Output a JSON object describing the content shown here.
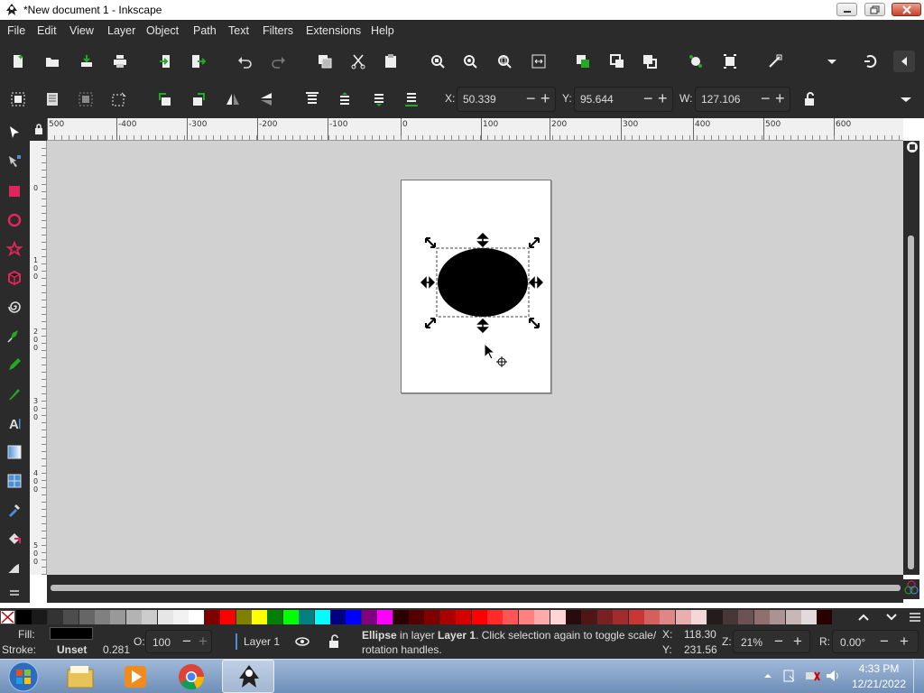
{
  "window": {
    "title": "*New document 1 - Inkscape"
  },
  "menu": [
    {
      "label": "File",
      "u": "F",
      "rest": "ile"
    },
    {
      "label": "Edit",
      "u": "E",
      "rest": "dit"
    },
    {
      "label": "View",
      "u": "V",
      "rest": "iew"
    },
    {
      "label": "Layer",
      "u": "L",
      "rest": "ayer"
    },
    {
      "label": "Object",
      "u": "O",
      "rest": "bject"
    },
    {
      "label": "Path",
      "u": "P",
      "rest": "ath"
    },
    {
      "label": "Text",
      "u": "T",
      "rest": "ext"
    },
    {
      "label": "Filters",
      "u": "F",
      "rest": "ilters"
    },
    {
      "label": "Extensions",
      "u": "x",
      "rest": "tensions",
      "pre": "E"
    },
    {
      "label": "Help",
      "u": "H",
      "rest": "elp"
    }
  ],
  "controls": {
    "x_label": "X:",
    "x_value": "50.339",
    "y_label": "Y:",
    "y_value": "95.644",
    "w_label": "W:",
    "w_value": "127.106"
  },
  "ruler": {
    "top_ticks": [
      "500",
      "-400",
      "-300",
      "-200",
      "-100",
      "0",
      "100",
      "200",
      "300",
      "400",
      "500",
      "600"
    ],
    "left_ticks": [
      "0",
      "1\n0\n0",
      "2\n0\n0",
      "3\n0\n0",
      "4\n0\n0",
      "5\n0\n0"
    ]
  },
  "status": {
    "fill_label": "Fill:",
    "stroke_label": "Stroke:",
    "stroke_value": "Unset",
    "stroke_width": "0.281",
    "opacity_label": "O:",
    "opacity_value": "100",
    "layer_name": "Layer 1",
    "message_bold": "Ellipse",
    "message_line1": " in layer ",
    "message_layer": "Layer 1",
    "message_line1b": ". Click selection again to toggle scale/",
    "message_line2": "rotation handles.",
    "cursor_x_label": "X:",
    "cursor_x": "118.30",
    "cursor_y_label": "Y:",
    "cursor_y": "231.56",
    "zoom_label": "Z:",
    "zoom_value": "21%",
    "rotation_label": "R:",
    "rotation_value": "0.00°"
  },
  "taskbar": {
    "time": "4:33 PM",
    "date": "12/21/2022"
  },
  "palette_colors": [
    "#000000",
    "#1a1a1a",
    "#333333",
    "#4d4d4d",
    "#666666",
    "#808080",
    "#999999",
    "#b3b3b3",
    "#cccccc",
    "#e6e6e6",
    "#f2f2f2",
    "#ffffff",
    "#800000",
    "#ff0000",
    "#808000",
    "#ffff00",
    "#008000",
    "#00ff00",
    "#008080",
    "#00ffff",
    "#000080",
    "#0000ff",
    "#800080",
    "#ff00ff",
    "#2b0000",
    "#550000",
    "#800000",
    "#aa0000",
    "#d40000",
    "#ff0000",
    "#ff2a2a",
    "#ff5555",
    "#ff8080",
    "#ffaaaa",
    "#ffd5d5",
    "#280b0b",
    "#501616",
    "#782121",
    "#a02c2c",
    "#c83737",
    "#d35f5f",
    "#de8787",
    "#e9afaf",
    "#f4d7d7",
    "#241c1c",
    "#483737",
    "#6c5353",
    "#916f6f",
    "#ac9393",
    "#c8b7b7",
    "#e3dbdb",
    "#280000"
  ],
  "colors": {
    "chrome": "#2b2b2b",
    "canvas": "#d1d1d1",
    "accent": "#4a90d9"
  }
}
